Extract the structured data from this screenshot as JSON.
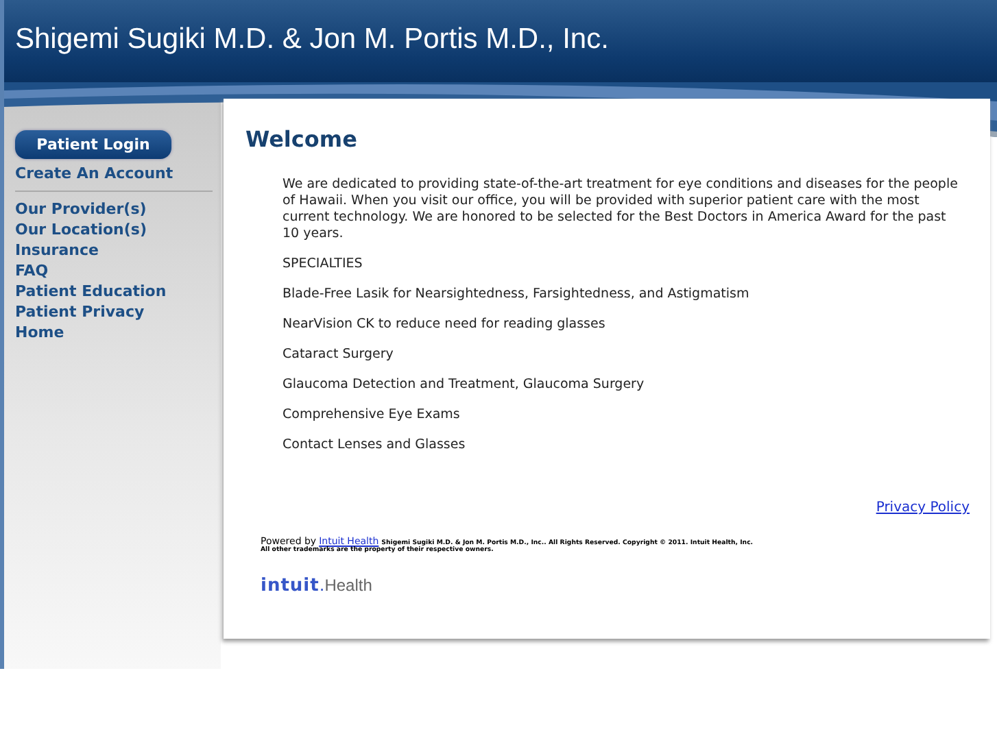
{
  "header": {
    "title": "Shigemi Sugiki M.D. & Jon M. Portis M.D., Inc."
  },
  "sidebar": {
    "login_button": "Patient Login",
    "account_link": "Create An Account",
    "items": [
      "Our Provider(s)",
      "Our Location(s)",
      "Insurance",
      "FAQ",
      "Patient Education",
      "Patient Privacy",
      "Home"
    ]
  },
  "main": {
    "heading": "Welcome",
    "intro": "We are dedicated to providing state-of-the-art treatment for eye conditions and diseases for the people of Hawaii. When you visit our office, you will be provided with superior patient care with the most current technology. We are honored to be selected for the Best Doctors in America Award for the past 10 years.",
    "specialties_heading": "SPECIALTIES",
    "specialties": [
      "Blade-Free Lasik for Nearsightedness, Farsightedness, and Astigmatism",
      "NearVision CK to reduce need for reading glasses",
      "Cataract Surgery",
      "Glaucoma Detection and Treatment, Glaucoma Surgery",
      "Comprehensive Eye Exams",
      "Contact Lenses and Glasses"
    ]
  },
  "footer": {
    "privacy_link": "Privacy Policy",
    "powered_by": "Powered by",
    "powered_link": "Intuit Health",
    "copyright": "Shigemi Sugiki M.D. & Jon M. Portis M.D., Inc.. All Rights Reserved. Copyright © 2011. Intuit Health, Inc.",
    "trademarks": "All other trademarks are the property of their respective owners.",
    "logo_brand": "intuit",
    "logo_dot": ".",
    "logo_product": "Health"
  }
}
